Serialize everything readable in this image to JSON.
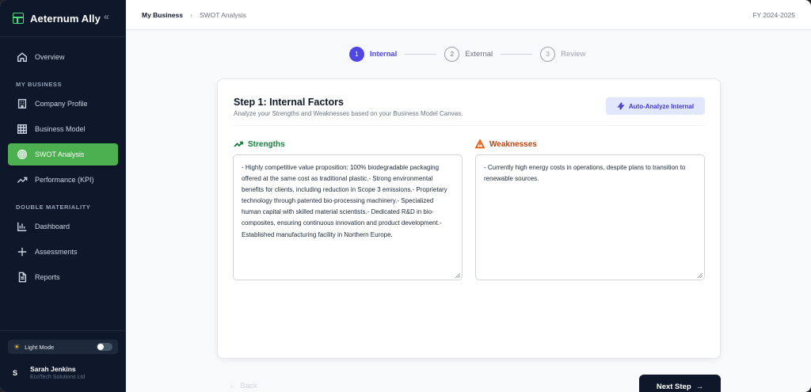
{
  "app": {
    "name": "Aeternum Ally",
    "collapse_glyph": "«"
  },
  "sidebar": {
    "overview": "Overview",
    "section_business": "MY BUSINESS",
    "company_profile": "Company Profile",
    "business_model": "Business Model",
    "swot": "SWOT Analysis",
    "performance": "Performance (KPI)",
    "section_materiality": "DOUBLE MATERIALITY",
    "dashboard": "Dashboard",
    "assessments": "Assessments",
    "reports": "Reports",
    "mode_label": "Light Mode",
    "user": {
      "initial": "S",
      "name": "Sarah Jenkins",
      "org": "EcoTech Solutions Ltd"
    }
  },
  "header": {
    "breadcrumb_root": "My Business",
    "breadcrumb_sep": "›",
    "breadcrumb_current": "SWOT Analysis",
    "fiscal_year": "FY 2024-2025"
  },
  "stepper": [
    {
      "num": "1",
      "label": "Internal"
    },
    {
      "num": "2",
      "label": "External"
    },
    {
      "num": "3",
      "label": "Review"
    }
  ],
  "card": {
    "title": "Step 1: Internal Factors",
    "subtitle": "Analyze your Strengths and Weaknesses based on your Business Model Canvas.",
    "auto_button": "Auto-Analyze Internal",
    "strengths_label": "Strengths",
    "weaknesses_label": "Weaknesses",
    "strengths_text": "- Highly competitive value proposition: 100% biodegradable packaging offered at the same cost as traditional plastic.- Strong environmental benefits for clients, including reduction in Scope 3 emissions.- Proprietary technology through patented bio-processing machinery.- Specialized human capital with skilled material scientists.- Dedicated R&D in bio-composites, ensuring continuous innovation and product development.- Established manufacturing facility in Northern Europe.",
    "weaknesses_text": "- Currently high energy costs in operations, despite plans to transition to renewable sources."
  },
  "footer": {
    "back_label": "Back",
    "next_label": "Next Step"
  },
  "colors": {
    "accent": "#4f46e5",
    "active_nav": "#4caf50",
    "strengths": "#15803d",
    "weaknesses": "#c2410c"
  }
}
